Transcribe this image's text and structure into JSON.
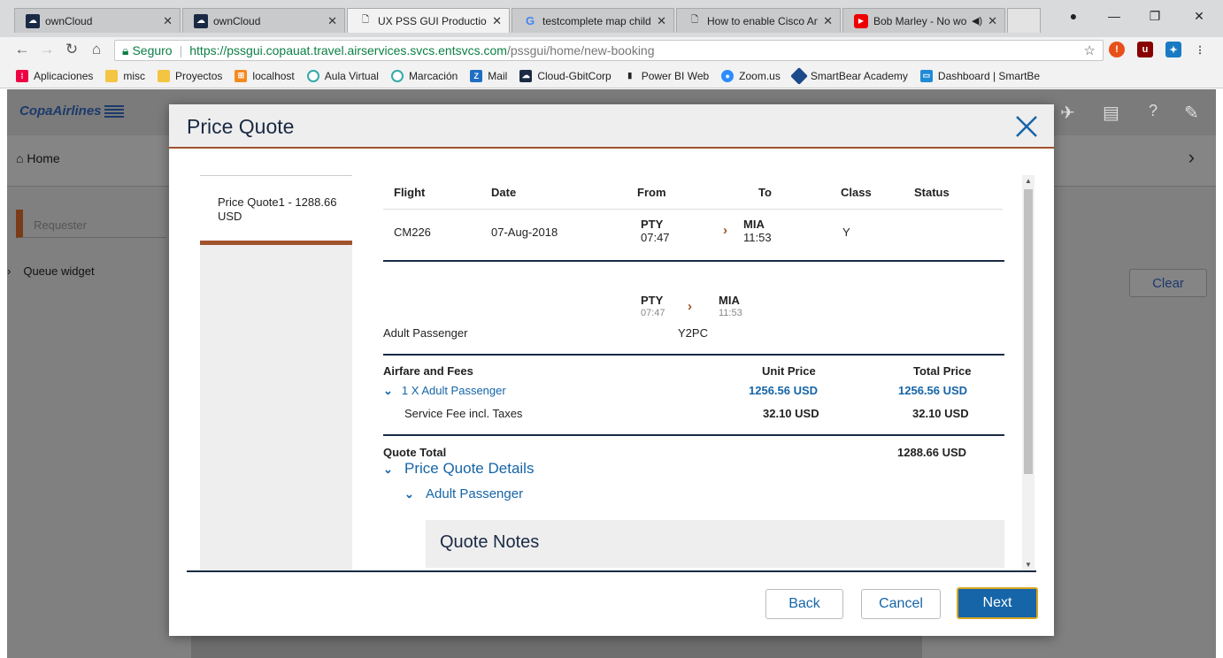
{
  "browser": {
    "tabs": [
      {
        "title": "ownCloud",
        "icon": "owncloud-icon",
        "active": false
      },
      {
        "title": "ownCloud",
        "icon": "owncloud-icon",
        "active": false
      },
      {
        "title": "UX PSS GUI Production",
        "icon": "page-icon",
        "active": true
      },
      {
        "title": "testcomplete map child",
        "icon": "google-icon",
        "active": false
      },
      {
        "title": "How to enable Cisco An",
        "icon": "page-icon",
        "active": false
      },
      {
        "title": "Bob Marley - No wo",
        "icon": "youtube-icon",
        "active": false
      }
    ],
    "security_label": "Seguro",
    "url_host": "https://pssgui.copauat.travel.airservices.svcs.entsvcs.com",
    "url_path": "/pssgui/home/new-booking",
    "bookmarks": [
      {
        "label": "Aplicaciones",
        "icon": "apps-icon",
        "color": "#e04"
      },
      {
        "label": "misc",
        "icon": "folder-icon",
        "color": "#f4c542"
      },
      {
        "label": "Proyectos",
        "icon": "folder-icon",
        "color": "#f4c542"
      },
      {
        "label": "localhost",
        "icon": "localhost-icon",
        "color": "#f58a1f"
      },
      {
        "label": "Aula Virtual",
        "icon": "aula-icon",
        "color": "#3aa"
      },
      {
        "label": "Marcación",
        "icon": "marcacion-icon",
        "color": "#3aa"
      },
      {
        "label": "Mail",
        "icon": "zimbra-icon",
        "color": "#1f6fc4"
      },
      {
        "label": "Cloud-GbitCorp",
        "icon": "owncloud-icon",
        "color": "#1a2a45"
      },
      {
        "label": "Power BI Web",
        "icon": "powerbi-icon",
        "color": "#222"
      },
      {
        "label": "Zoom.us",
        "icon": "zoom-icon",
        "color": "#2d8cff"
      },
      {
        "label": "SmartBear Academy",
        "icon": "smartbear-icon",
        "color": "#1a4a8a"
      },
      {
        "label": "Dashboard | SmartBe",
        "icon": "dashboard-icon",
        "color": "#1f8ad6"
      }
    ]
  },
  "app": {
    "logo": "CopaAirlines",
    "home_label": "Home",
    "requester_placeholder": "Requester",
    "queue_widget": "Queue widget",
    "clear_label": "Clear"
  },
  "modal": {
    "title": "Price Quote",
    "sidebar_item": "Price Quote1 - 1288.66 USD",
    "flight_table": {
      "headers": [
        "Flight",
        "Date",
        "From",
        "To",
        "Class",
        "Status"
      ],
      "row": {
        "flight": "CM226",
        "date": "07-Aug-2018",
        "from_code": "PTY",
        "from_time": "07:47",
        "to_code": "MIA",
        "to_time": "11:53",
        "class": "Y",
        "status": ""
      }
    },
    "segment": {
      "from_code": "PTY",
      "from_time": "07:47",
      "to_code": "MIA",
      "to_time": "11:53",
      "fare_basis": "Y2PC"
    },
    "passenger_type": "Adult Passenger",
    "fares": {
      "header_label": "Airfare and Fees",
      "unit_price_label": "Unit Price",
      "total_price_label": "Total Price",
      "passenger_line": "1 X Adult Passenger",
      "passenger_unit": "1256.56 USD",
      "passenger_total": "1256.56 USD",
      "fee_label": "Service Fee incl. Taxes",
      "fee_unit": "32.10 USD",
      "fee_total": "32.10 USD",
      "quote_total_label": "Quote Total",
      "quote_total": "1288.66 USD"
    },
    "details_label": "Price Quote Details",
    "details_passenger": "Adult Passenger",
    "notes_label": "Quote Notes",
    "buttons": {
      "back": "Back",
      "cancel": "Cancel",
      "next": "Next"
    }
  }
}
